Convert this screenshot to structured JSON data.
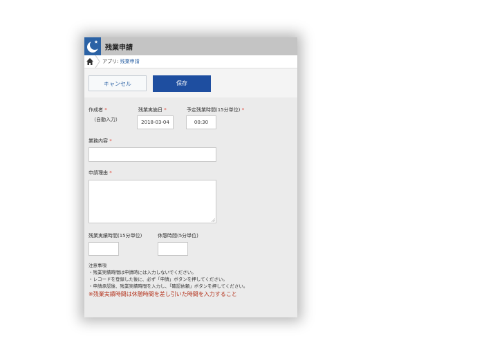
{
  "window": {
    "title": "残業申請",
    "icon": "crescent-moon-icon",
    "accent_color": "#2b62a5"
  },
  "breadcrumb": {
    "prefix": "アプリ: ",
    "current": "残業申請"
  },
  "toolbar": {
    "cancel_label": "キャンセル",
    "save_label": "保存",
    "save_color": "#1e4ea0"
  },
  "form": {
    "author": {
      "label": "作成者",
      "required_mark": "*",
      "value": "（自動入力）"
    },
    "overtime_date": {
      "label": "残業実施日",
      "required_mark": "*",
      "value": "2018-03-04"
    },
    "planned_hours": {
      "label": "予定残業時間(15分単位)",
      "required_mark": "*",
      "value": "00:30"
    },
    "work_content": {
      "label": "業務内容",
      "required_mark": "*",
      "value": ""
    },
    "reason": {
      "label": "申請理由",
      "required_mark": "*",
      "value": ""
    },
    "actual_hours": {
      "label": "残業実績時間(15分単位)",
      "value": ""
    },
    "break_time": {
      "label": "休憩時間(5分単位)",
      "value": ""
    }
  },
  "notes": {
    "heading": "注意事項",
    "lines": [
      "・残業実績時間は申請時には入力しないでください。",
      "・レコードを登録した後に、必ず「申請」ボタンを押してください。",
      "・申請承認後、残業実績時間を入力し、「確認依頼」ボタンを押してください。"
    ],
    "warning": "※残業実績時間は休憩時間を差し引いた時間を入力すること",
    "warning_color": "#b4331c"
  }
}
